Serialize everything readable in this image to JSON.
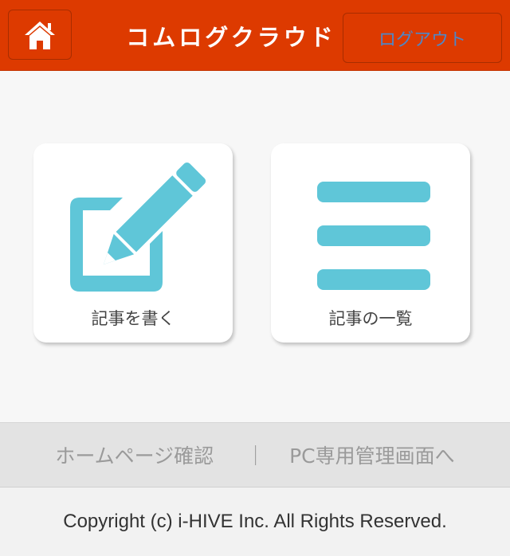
{
  "header": {
    "title": "コムログクラウド",
    "logout_label": "ログアウト",
    "home_icon": "home-icon",
    "background_color": "#dd3a00"
  },
  "main": {
    "cards": [
      {
        "label": "記事を書く",
        "icon": "edit-icon"
      },
      {
        "label": "記事の一覧",
        "icon": "list-icon"
      }
    ],
    "icon_color": "#5fc6d8"
  },
  "links": {
    "homepage_label": "ホームページ確認",
    "separator": "｜",
    "pc_admin_label": "PC専用管理画面へ"
  },
  "footer": {
    "copyright": "Copyright (c) i-HIVE Inc. All Rights Reserved."
  }
}
